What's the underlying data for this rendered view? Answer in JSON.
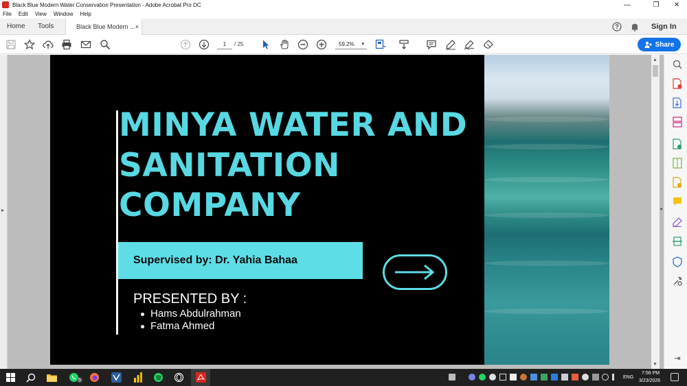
{
  "window": {
    "title": "Black Blue Modern Water Conservation Presentation - Adobe Acrobat Pro DC",
    "minimize_glyph": "—",
    "restore_glyph": "❐",
    "close_glyph": "✕"
  },
  "menu": {
    "items": [
      "File",
      "Edit",
      "View",
      "Window",
      "Help"
    ]
  },
  "tabs": {
    "home": "Home",
    "tools": "Tools",
    "document": "Black Blue Modern ...",
    "close_glyph": "×"
  },
  "header": {
    "help_icon": "question-circle-icon",
    "notifications_icon": "bell-icon",
    "sign_in": "Sign In"
  },
  "toolbar": {
    "current_page": "1",
    "total_pages": "/ 25",
    "zoom": "59.2%",
    "zoom_caret": "▾",
    "share_label": "Share",
    "accent_color": "#1473e6"
  },
  "slide": {
    "title_lines": [
      "MINYA WATER AND",
      "SANITATION",
      "COMPANY"
    ],
    "supervised": "Supervised by: Dr. Yahia Bahaa",
    "presented_by": "PRESENTED BY :",
    "presenters": [
      "Hams Abdulrahman",
      "Fatma Ahmed"
    ],
    "accent_color": "#5ddde6",
    "background_color": "#000000"
  },
  "panels": {
    "left_collapse_glyph": "▸",
    "right_collapse_glyph": "◂",
    "scroll_up_glyph": "▲",
    "scroll_down_glyph": "▼",
    "right_expand_glyph": "⇥"
  },
  "taskbar": {
    "whatsapp_badge": "5",
    "language": "ENG",
    "time": "7:56 PM",
    "date": "3/23/2026"
  }
}
